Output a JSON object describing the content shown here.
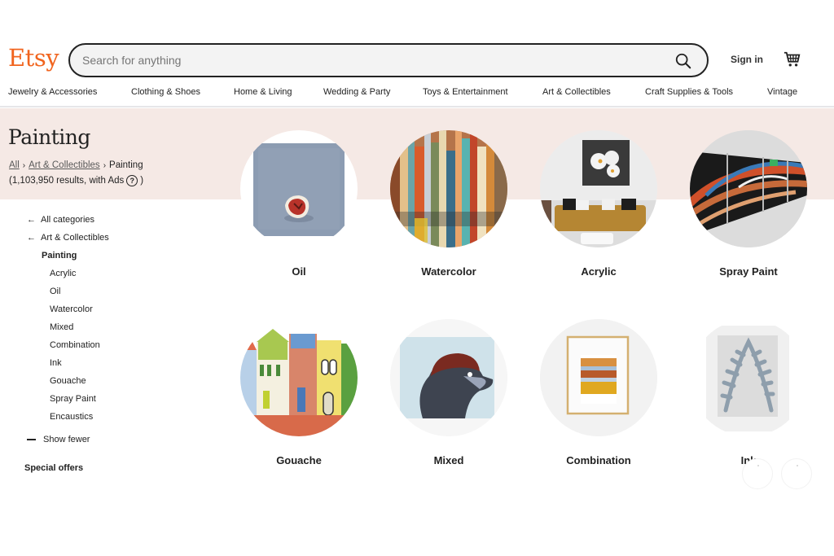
{
  "header": {
    "logo": "Etsy",
    "search_placeholder": "Search for anything",
    "search_value": "",
    "sign_in": "Sign in",
    "icons": {
      "search": "search-icon",
      "cart": "cart-icon"
    }
  },
  "categories_nav": [
    "Jewelry & Accessories",
    "Clothing & Shoes",
    "Home & Living",
    "Wedding & Party",
    "Toys & Entertainment",
    "Art & Collectibles",
    "Craft Supplies & Tools",
    "Vintage"
  ],
  "page": {
    "title": "Painting",
    "breadcrumb": [
      "All",
      "Art & Collectibles",
      "Painting"
    ],
    "results_text": "(1,103,950 results, with Ads",
    "results_close": ")",
    "help_glyph": "?"
  },
  "sidebar": {
    "back_links": [
      "All categories",
      "Art & Collectibles"
    ],
    "current": "Painting",
    "subcategories": [
      "Acrylic",
      "Oil",
      "Watercolor",
      "Mixed",
      "Combination",
      "Ink",
      "Gouache",
      "Spray Paint",
      "Encaustics"
    ],
    "show_fewer": "Show fewer",
    "special_offers": "Special offers"
  },
  "category_cards": [
    {
      "label": "Oil"
    },
    {
      "label": "Watercolor"
    },
    {
      "label": "Acrylic"
    },
    {
      "label": "Spray Paint"
    },
    {
      "label": "Gouache"
    },
    {
      "label": "Mixed"
    },
    {
      "label": "Combination"
    },
    {
      "label": "Ink"
    }
  ],
  "colors": {
    "brand": "#f1641e",
    "band": "#f5e9e5",
    "text": "#222222"
  }
}
